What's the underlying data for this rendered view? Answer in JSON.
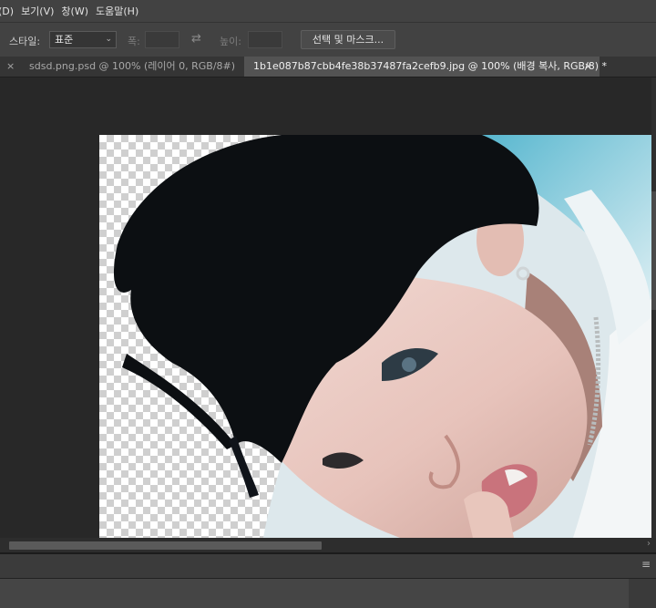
{
  "menubar": {
    "items": [
      "(D)",
      "보기(V)",
      "창(W)",
      "도움말(H)"
    ]
  },
  "options_bar": {
    "style_label": "스타일:",
    "style_value": "표준",
    "width_label": "폭:",
    "swap_symbol": "⇄",
    "height_label": "높이:",
    "select_and_mask_label": "선택 및 마스크..."
  },
  "tabs": [
    {
      "close": "×",
      "label": "sdsd.png.psd @ 100% (레이어 0, RGB/8#)",
      "active": false
    },
    {
      "close": "×",
      "label": "1b1e087b87cbb4fe38b37487fa2cefb9.jpg @ 100% (배경 복사, RGB/8) *",
      "active": true
    }
  ],
  "canvas": {
    "zoom": "100%",
    "transparency_visible": true
  },
  "scrollbar": {
    "right_arrow": "›"
  },
  "panel": {
    "menu_icon": "≡"
  }
}
